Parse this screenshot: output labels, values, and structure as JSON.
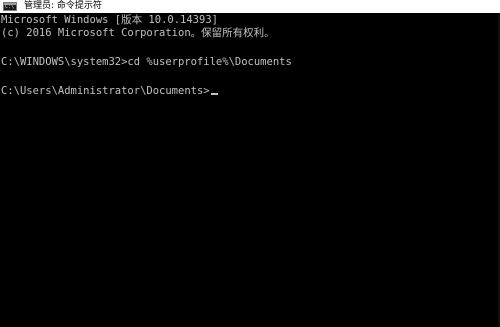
{
  "window": {
    "title": "管理员: 命令提示符",
    "icon": "console-icon",
    "icon_glyph": "C:\\"
  },
  "console": {
    "lines": [
      "Microsoft Windows [版本 10.0.14393]",
      "(c) 2016 Microsoft Corporation。保留所有权利。",
      "",
      "C:\\WINDOWS\\system32>cd %userprofile%\\Documents",
      "",
      "C:\\Users\\Administrator\\Documents>"
    ]
  },
  "colors": {
    "background": "#000000",
    "text": "#c0c0c0",
    "titlebar": "#ffffff"
  }
}
